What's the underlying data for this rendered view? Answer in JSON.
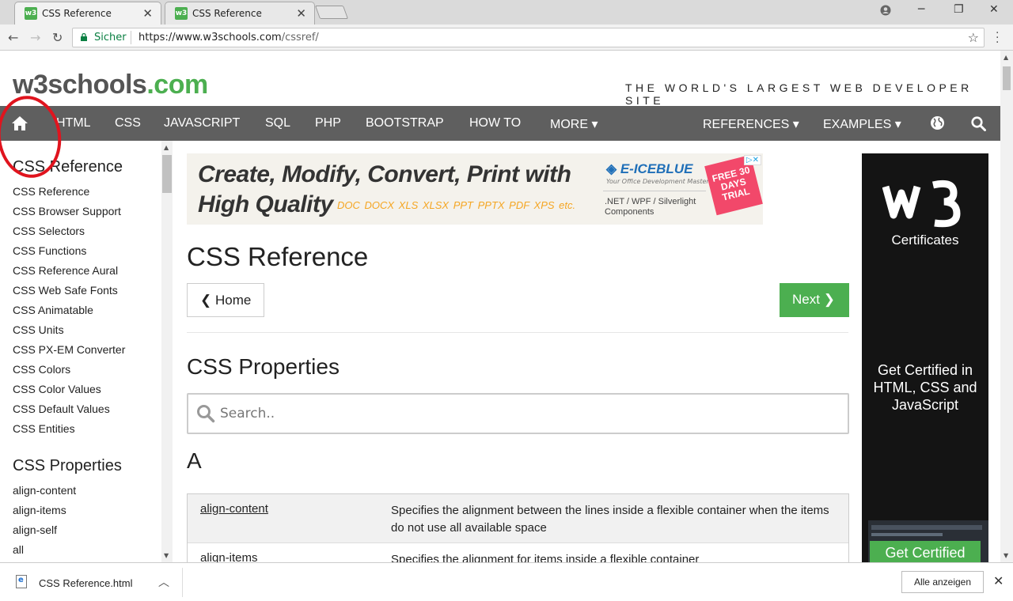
{
  "browser": {
    "tabs": [
      {
        "title": "CSS Reference",
        "favicon": "w3"
      },
      {
        "title": "CSS Reference",
        "favicon": "w3"
      }
    ],
    "secure_label": "Sicher",
    "url_host": "https://www.w3schools.com",
    "url_path": "/cssref/"
  },
  "site": {
    "logo_main": "w3schools",
    "logo_tld": ".com",
    "tagline": "THE WORLD'S LARGEST WEB DEVELOPER SITE"
  },
  "topnav": {
    "items": [
      "HTML",
      "CSS",
      "JAVASCRIPT",
      "SQL",
      "PHP",
      "BOOTSTRAP",
      "HOW TO",
      "MORE ▾"
    ],
    "right_items": [
      "REFERENCES ▾",
      "EXAMPLES ▾"
    ]
  },
  "sidebar": {
    "heading1": "CSS Reference",
    "links1": [
      "CSS Reference",
      "CSS Browser Support",
      "CSS Selectors",
      "CSS Functions",
      "CSS Reference Aural",
      "CSS Web Safe Fonts",
      "CSS Animatable",
      "CSS Units",
      "CSS PX-EM Converter",
      "CSS Colors",
      "CSS Color Values",
      "CSS Default Values",
      "CSS Entities"
    ],
    "heading2": "CSS Properties",
    "links2": [
      "align-content",
      "align-items",
      "align-self",
      "all"
    ]
  },
  "ad": {
    "line1": "Create, Modify, Convert, Print with",
    "line2": "High Quality",
    "formats": "DOC DOCX XLS XLSX PPT PPTX PDF XPS etc.",
    "brand": "E-ICEBLUE",
    "brand_sub": "Your Office Development Master",
    "platforms": ".NET / WPF / Silverlight Components",
    "badge": "FREE 30 DAYS TRIAL"
  },
  "main": {
    "title": "CSS Reference",
    "home_button": "Home",
    "next_button": "Next",
    "section_title": "CSS Properties",
    "search_placeholder": "Search..",
    "letter": "A",
    "properties": [
      {
        "name": "align-content",
        "description": "Specifies the alignment between the lines inside a flexible container when the items do not use all available space"
      },
      {
        "name": "align-items",
        "description": "Specifies the alignment for items inside a flexible container"
      }
    ]
  },
  "right_ad": {
    "certificates": "Certificates",
    "get_certified_text": "Get Certified in HTML, CSS and JavaScript",
    "button": "Get Certified"
  },
  "downloads": {
    "file_name": "CSS Reference.html",
    "show_all": "Alle anzeigen"
  },
  "colors": {
    "nav_bg": "#5f5f5f",
    "brand_green": "#4caf50",
    "annotation_red": "#e0141e"
  }
}
